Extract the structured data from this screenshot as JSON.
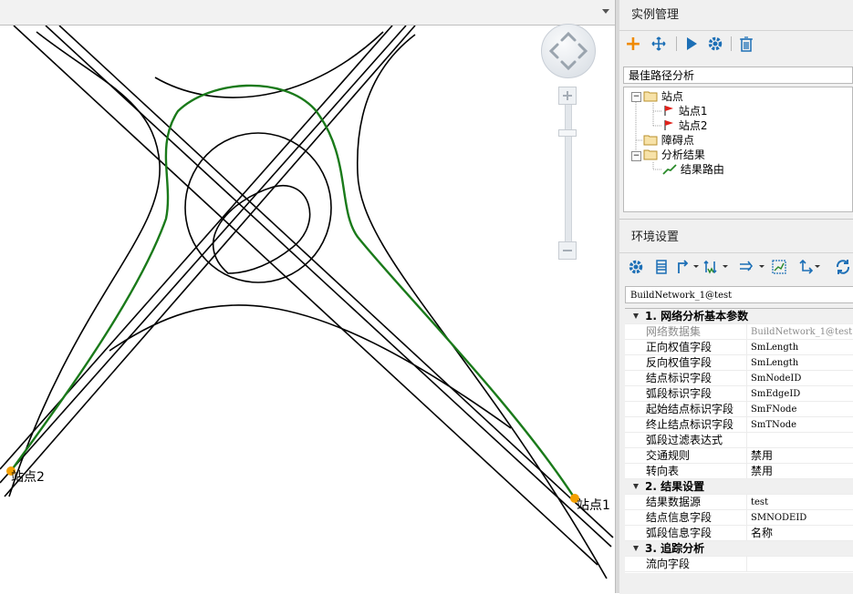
{
  "map": {
    "sites": [
      {
        "label": "站点2",
        "color": "#f4a000"
      },
      {
        "label": "站点1",
        "color": "#f4a000"
      }
    ],
    "route_color": "#1a7a1a",
    "road_color": "#000000"
  },
  "instance_panel": {
    "title": "实例管理",
    "toolbar": [
      "add-icon",
      "move-icon",
      "run-icon",
      "settings-icon",
      "delete-icon"
    ],
    "instance_select": "最佳路径分析",
    "tree": {
      "sites_folder": "站点",
      "site1": "站点1",
      "site2": "站点2",
      "barriers": "障碍点",
      "results_folder": "分析结果",
      "result_route": "结果路由"
    }
  },
  "env_panel": {
    "title": "环境设置",
    "toolbar": [
      "settings-icon",
      "dataset-icon",
      "path-icon",
      "weight-icon",
      "direction-icon",
      "grid-icon",
      "coordinate-icon",
      "refresh-icon"
    ],
    "network_select": "BuildNetwork_1@test",
    "categories": [
      {
        "title": "1. 网络分析基本参数",
        "rows": [
          {
            "name": "网络数据集",
            "value": "BuildNetwork_1@test",
            "muted": true
          },
          {
            "name": "正向权值字段",
            "value": "SmLength"
          },
          {
            "name": "反向权值字段",
            "value": "SmLength"
          },
          {
            "name": "结点标识字段",
            "value": "SmNodeID"
          },
          {
            "name": "弧段标识字段",
            "value": "SmEdgeID"
          },
          {
            "name": "起始结点标识字段",
            "value": "SmFNode"
          },
          {
            "name": "终止结点标识字段",
            "value": "SmTNode"
          },
          {
            "name": "弧段过滤表达式",
            "value": ""
          },
          {
            "name": "交通规则",
            "value": "禁用"
          },
          {
            "name": "转向表",
            "value": "禁用"
          }
        ]
      },
      {
        "title": "2. 结果设置",
        "rows": [
          {
            "name": "结果数据源",
            "value": "test"
          },
          {
            "name": "结点信息字段",
            "value": "SMNODEID"
          },
          {
            "name": "弧段信息字段",
            "value": "名称"
          }
        ]
      },
      {
        "title": "3. 追踪分析",
        "rows": [
          {
            "name": "流向字段",
            "value": ""
          }
        ]
      }
    ]
  }
}
